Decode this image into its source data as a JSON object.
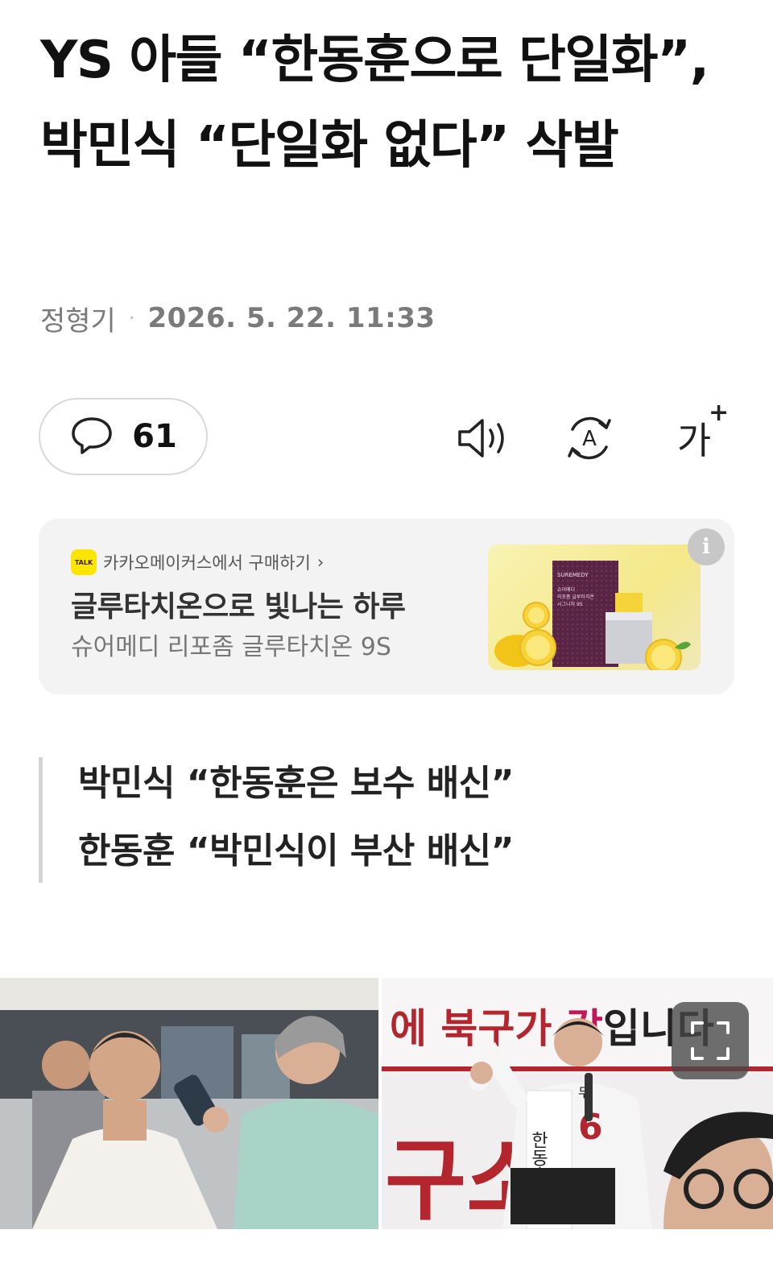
{
  "article": {
    "headline": "YS 아들 “한동훈으로 단일화”, 박민식 “단일화 없다” 삭발",
    "author": "정형기",
    "date": "2026. 5. 22. 11:33"
  },
  "toolbar": {
    "comment_count": "61",
    "speaker_icon": "speaker-icon",
    "translate_icon": "translate-icon",
    "fontsize_label": "가",
    "fontsize_plus": "+"
  },
  "ad": {
    "source": "카카오메이커스에서 구매하기",
    "source_chevron": "›",
    "talk_badge": "TALK",
    "title": "글루타치온으로 빛나는 하루",
    "subtitle": "슈어메디 리포좀 글루타치온 9S",
    "info_label": "i",
    "product_brand": "SUREMEDY",
    "product_name_1": "슈어메디",
    "product_name_2": "리포좀 글루타치온",
    "product_name_3": "시그니처 9S"
  },
  "summary": {
    "line1": "박민식 “한동훈은 보수 배신”",
    "line2": "한동훈 “박민식이 부산 배신”"
  },
  "photo_right": {
    "banner_text_1": "에 북구가 ",
    "banner_text_2": "갑",
    "banner_text_3": "입니다",
    "sash_name": "한동훈",
    "sash_number": "6",
    "sash_prefix": "무",
    "big_text": "구소"
  },
  "colors": {
    "accent_kakao": "#fee500",
    "banner_red": "#b3262e",
    "ad_bg": "#f3f3f3"
  }
}
